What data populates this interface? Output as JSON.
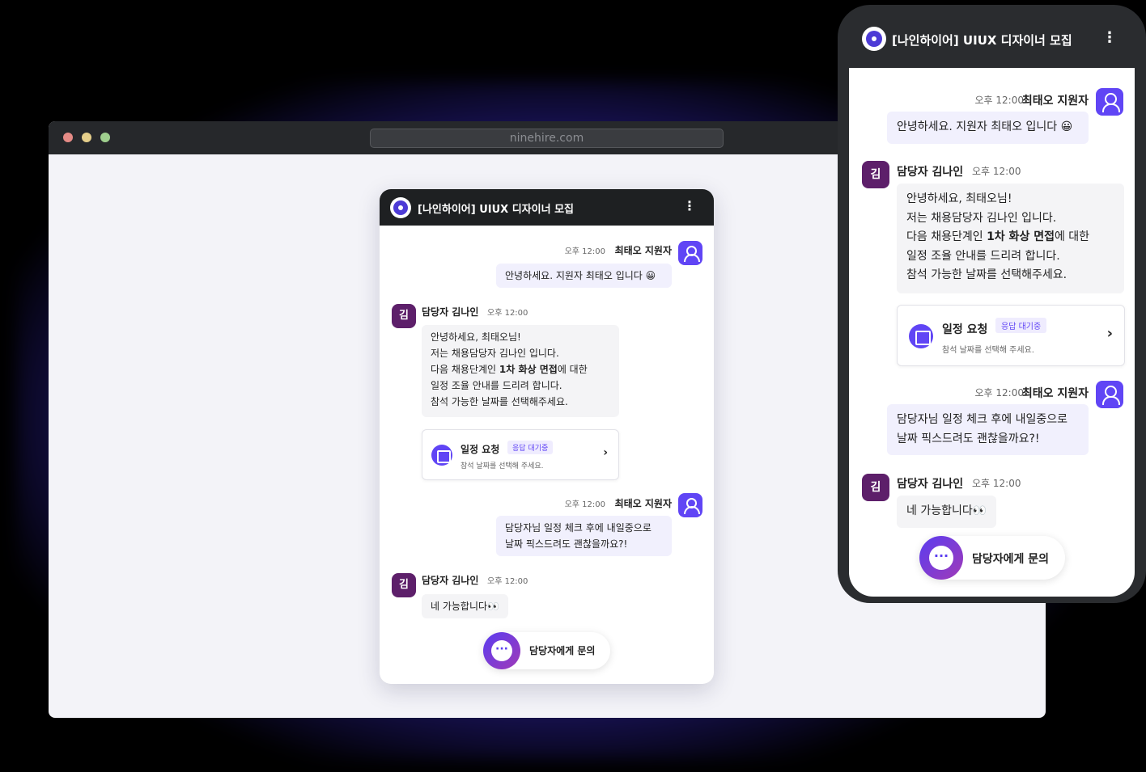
{
  "browser": {
    "url": "ninehire.com"
  },
  "chat": {
    "title": "[나인하이어] UIUX 디자이너 모집",
    "menu_icon": "kebab-menu-icon",
    "messages": [
      {
        "sender": "최태오 지원자",
        "time": "오후 12:00",
        "text": "안녕하세요. 지원자 최태오 입니다 😀"
      },
      {
        "sender": "담당자 김나인",
        "time": "오후 12:00",
        "avatar": "김",
        "line1": "안녕하세요, 최태오님!",
        "line2": "저는 채용담당자 김나인 입니다.",
        "line3_pre": "다음 채용단계인 ",
        "line3_bold": "1차 화상 면접",
        "line3_post": "에 대한",
        "line4": "일정 조율 안내를 드리려 합니다.",
        "line5": "참석 가능한 날짜를 선택해주세요."
      },
      {
        "sender": "최태오 지원자",
        "time": "오후 12:00",
        "line1": "담당자님 일정 체크 후에 내일중으로",
        "line2": "날짜 픽스드려도 괜찮을까요?!"
      },
      {
        "sender": "담당자 김나인",
        "time": "오후 12:00",
        "avatar": "김",
        "text": "네 가능합니다👀"
      }
    ],
    "schedule_card": {
      "title": "일정 요청",
      "badge": "응답 대기중",
      "subtitle": "참석 날짜를 선택해 주세요."
    },
    "contact_button": "담당자에게 문의"
  },
  "colors": {
    "accent": "#6045f5",
    "manager_avatar": "#5d1f6a",
    "header": "#1e2022"
  }
}
